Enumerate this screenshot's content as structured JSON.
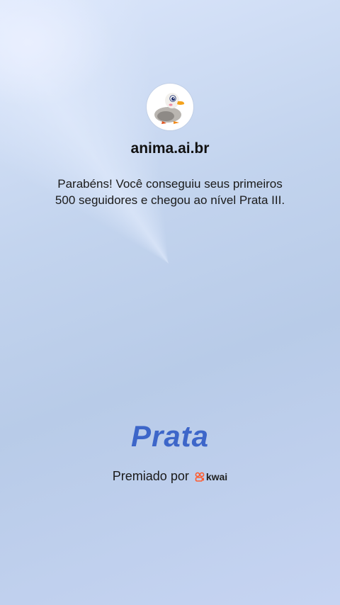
{
  "profile": {
    "avatar_icon": "duck-avatar-icon",
    "username": "anima.ai.br"
  },
  "message": {
    "line1": "Parabéns! Você conseguiu seus primeiros",
    "line2": "500 seguidores e chegou ao nível Prata III."
  },
  "level": {
    "name": "Prata",
    "color": "#3d66c9"
  },
  "award": {
    "label": "Premiado por",
    "brand_name": "kwai",
    "brand_icon": "kwai-logo-icon",
    "brand_color": "#ff5b2e"
  },
  "colors": {
    "background_top": "#dbe6fb",
    "background_bottom": "#c6d4f2"
  }
}
